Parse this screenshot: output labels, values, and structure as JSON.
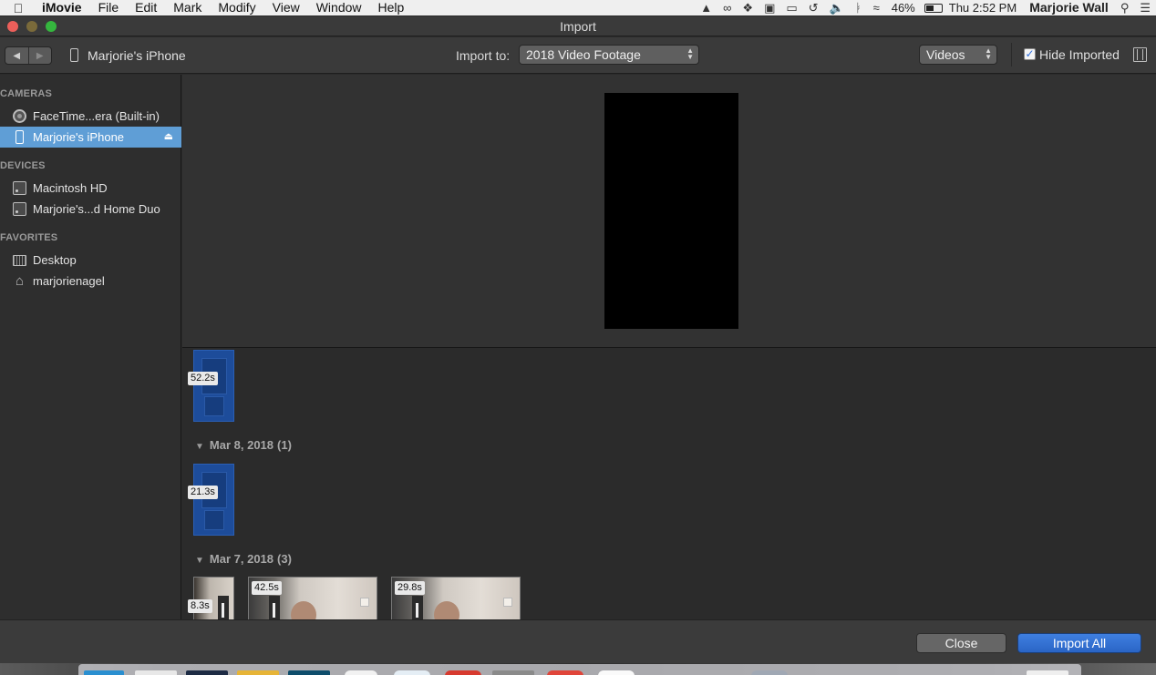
{
  "menubar": {
    "app": "iMovie",
    "menus": [
      "File",
      "Edit",
      "Mark",
      "Modify",
      "View",
      "Window",
      "Help"
    ],
    "battery": "46%",
    "clock": "Thu 2:52 PM",
    "user": "Marjorie Wall"
  },
  "window": {
    "title": "Import"
  },
  "toolbar": {
    "device_name": "Marjorie's iPhone",
    "import_to_label": "Import to:",
    "import_to_value": "2018 Video Footage",
    "filter_value": "Videos",
    "hide_imported_label": "Hide Imported",
    "hide_imported_checked": true
  },
  "sidebar": {
    "sections": [
      {
        "title": "CAMERAS",
        "items": [
          {
            "label": "FaceTime...era (Built-in)",
            "icon": "camera-icon"
          },
          {
            "label": "Marjorie's iPhone",
            "icon": "iphone-icon",
            "selected": true
          }
        ]
      },
      {
        "title": "DEVICES",
        "items": [
          {
            "label": "Macintosh HD",
            "icon": "hard-disk-icon"
          },
          {
            "label": "Marjorie's...d Home Duo",
            "icon": "hard-disk-icon"
          }
        ]
      },
      {
        "title": "FAVORITES",
        "items": [
          {
            "label": "Desktop",
            "icon": "desktop-folder-icon"
          },
          {
            "label": "marjorienagel",
            "icon": "home-icon"
          }
        ]
      }
    ]
  },
  "clips": {
    "top": [
      {
        "duration": "52.2s"
      }
    ],
    "groups": [
      {
        "date": "Mar 8, 2018",
        "count": "(1)",
        "clips": [
          {
            "duration": "21.3s"
          }
        ]
      },
      {
        "date": "Mar 7, 2018",
        "count": "(3)",
        "clips": [
          {
            "duration": "8.3s"
          },
          {
            "duration": "42.5s"
          },
          {
            "duration": "29.8s"
          }
        ]
      }
    ]
  },
  "buttons": {
    "close": "Close",
    "import_all": "Import All"
  },
  "colors": {
    "accent": "#2a65c6",
    "selection": "#5f9ed6",
    "clip_blue": "#1d4c9a"
  }
}
